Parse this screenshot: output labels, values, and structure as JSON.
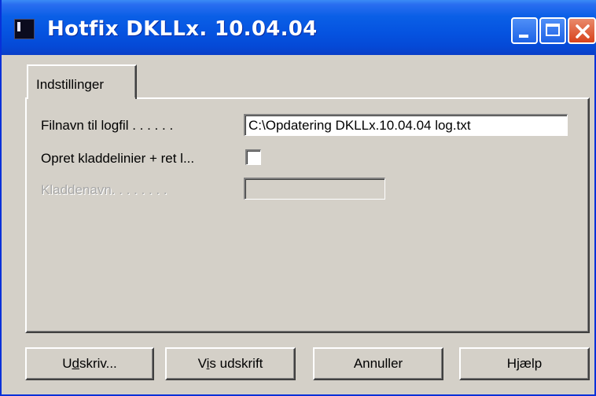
{
  "window": {
    "title": "Hotfix DKLLx. 10.04.04"
  },
  "tabs": [
    {
      "label": "Indstillinger"
    }
  ],
  "fields": {
    "logfile": {
      "label": "Filnavn til logfil . . . . . .",
      "value": "C:\\Opdatering DKLLx.10.04.04 log.txt"
    },
    "create_lines": {
      "label": "Opret kladdelinier + ret l...",
      "checked": false
    },
    "journal_name": {
      "label": "Kladdenavn. . . . . . . .",
      "value": ""
    }
  },
  "buttons": {
    "print": {
      "pre": "U",
      "accel": "d",
      "post": "skriv..."
    },
    "preview": {
      "pre": "V",
      "accel": "i",
      "post": "s udskrift"
    },
    "cancel": {
      "label": "Annuller"
    },
    "help": {
      "label": "Hjælp"
    }
  }
}
